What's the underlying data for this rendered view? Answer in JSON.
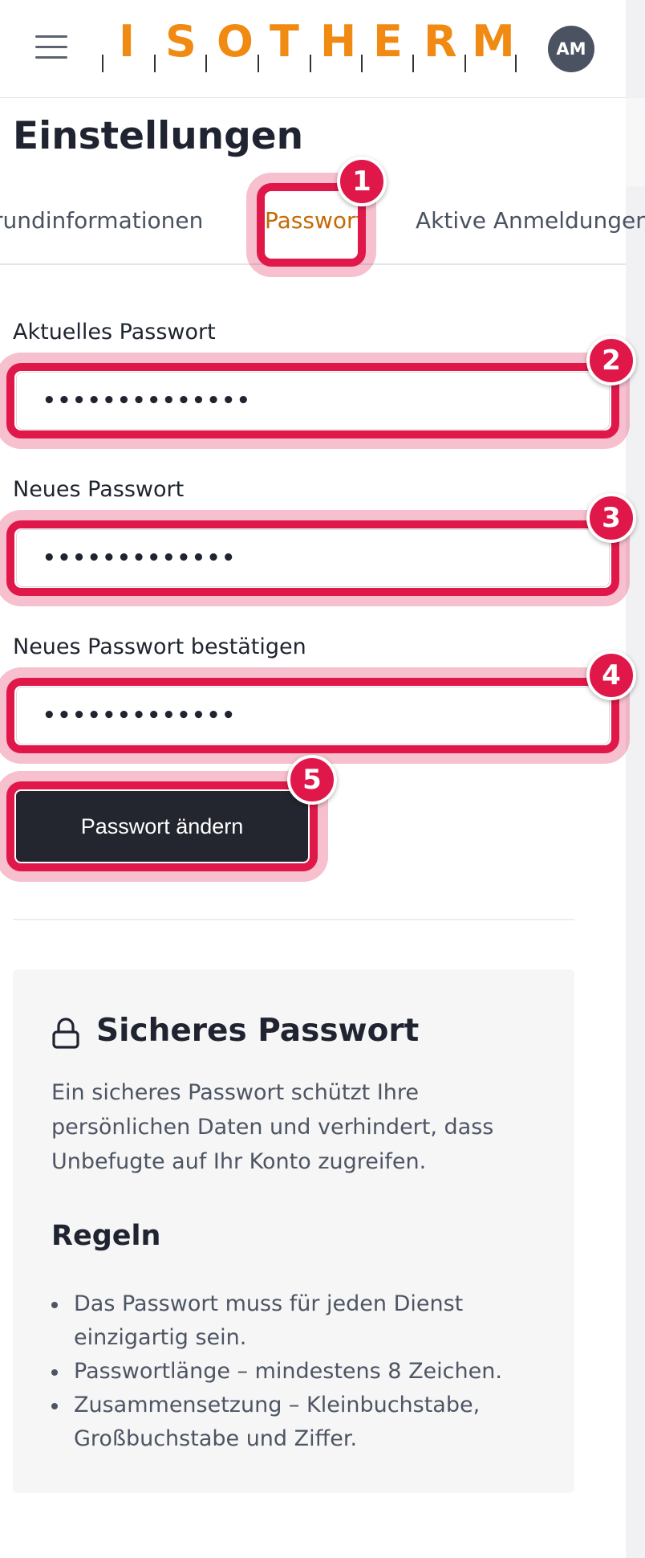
{
  "header": {
    "logo_text": "ISOTHERM",
    "logo_letters": [
      "I",
      "S",
      "O",
      "T",
      "H",
      "E",
      "R",
      "M"
    ],
    "avatar_initials": "AM",
    "menu_icon": "hamburger-menu-icon"
  },
  "page": {
    "title": "Einstellungen"
  },
  "tabs": [
    {
      "label": "Grundinformationen",
      "visible_label": "rundinformationen",
      "active": false
    },
    {
      "label": "Passwort",
      "visible_label": "Passwort",
      "active": true
    },
    {
      "label": "Aktive Anmeldungen",
      "visible_label": "Aktive Anmeldungen",
      "active": false
    }
  ],
  "form": {
    "current_password": {
      "label": "Aktuelles Passwort",
      "value": "••••••••••••••"
    },
    "new_password": {
      "label": "Neues Passwort",
      "value": "•••••••••••••"
    },
    "confirm_password": {
      "label": "Neues Passwort bestätigen",
      "value": "•••••••••••••"
    },
    "submit_label": "Passwort ändern"
  },
  "annotations": [
    "1",
    "2",
    "3",
    "4",
    "5"
  ],
  "info": {
    "icon": "lock-icon",
    "title": "Sicheres Passwort",
    "text": "Ein sicheres Passwort schützt Ihre persönlichen Daten und verhindert, dass Unbefugte auf Ihr Konto zugreifen.",
    "rules_title": "Regeln",
    "rules": [
      "Das Passwort muss für jeden Dienst einzigartig sein.",
      "Passwortlänge – mindestens 8 Zeichen.",
      "Zusammensetzung – Kleinbuchstabe, Großbuchstabe und Ziffer."
    ]
  },
  "colors": {
    "logo": "#f08a12",
    "active_tab": "#c46a06",
    "annotation": "#e0184a",
    "button_bg": "#23262e",
    "avatar_bg": "#4b5262"
  }
}
